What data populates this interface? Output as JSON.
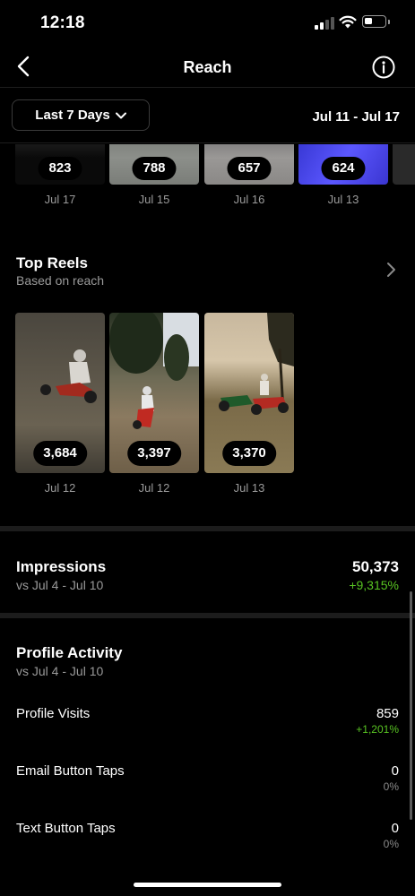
{
  "status_bar": {
    "time": "12:18"
  },
  "nav": {
    "title": "Reach"
  },
  "filter": {
    "range_label": "Last 7 Days",
    "date_range": "Jul 11 - Jul 17"
  },
  "stories": [
    {
      "value": "823",
      "date": "Jul 17"
    },
    {
      "value": "788",
      "date": "Jul 15"
    },
    {
      "value": "657",
      "date": "Jul 16"
    },
    {
      "value": "624",
      "date": "Jul 13"
    }
  ],
  "top_reels": {
    "title": "Top Reels",
    "subtitle": "Based on reach",
    "items": [
      {
        "value": "3,684",
        "date": "Jul 12"
      },
      {
        "value": "3,397",
        "date": "Jul 12"
      },
      {
        "value": "3,370",
        "date": "Jul 13"
      }
    ]
  },
  "impressions": {
    "title": "Impressions",
    "comparison": "vs Jul 4 - Jul 10",
    "value": "50,373",
    "change": "+9,315%"
  },
  "profile_activity": {
    "title": "Profile Activity",
    "comparison": "vs Jul 4 - Jul 10",
    "rows": [
      {
        "label": "Profile Visits",
        "value": "859",
        "change": "+1,201%"
      },
      {
        "label": "Email Button Taps",
        "value": "0",
        "change": "0%"
      },
      {
        "label": "Text Button Taps",
        "value": "0",
        "change": "0%"
      }
    ]
  },
  "colors": {
    "background": "#000000",
    "positive": "#58c322",
    "muted": "#9a9a9a"
  },
  "icons": [
    "back-arrow-icon",
    "info-icon",
    "chevron-down-icon",
    "chevron-right-icon",
    "signal-icon",
    "wifi-icon",
    "battery-icon"
  ]
}
